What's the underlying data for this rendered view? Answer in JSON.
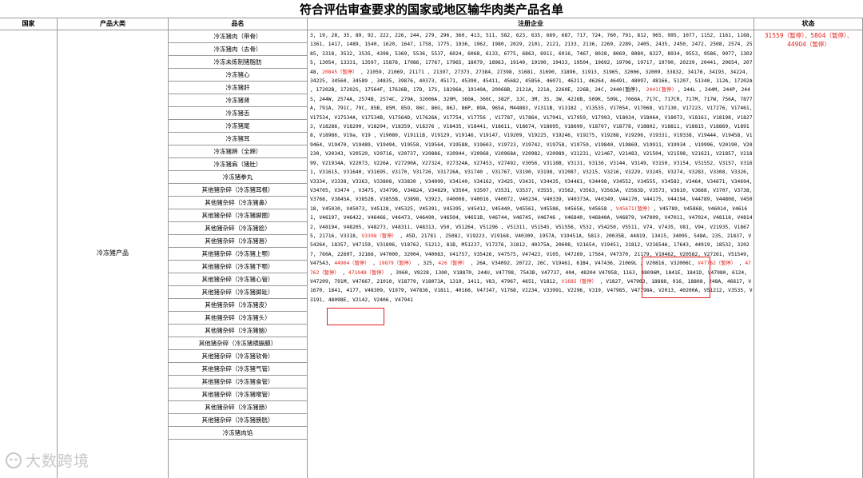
{
  "title": "符合评估审查要求的国家或地区输华肉类产品名单",
  "columns": {
    "country": "国家",
    "category": "产品大类",
    "product": "品名",
    "enterprises": "注册企业",
    "status": "状态"
  },
  "category": "冷冻猪产品",
  "products": [
    "冷冻猪肉（带骨）",
    "冷冻猪肉（去骨）",
    "冷冻未炼制猪脂肪",
    "冷冻猪心",
    "冷冻猪肝",
    "冷冻猪肾",
    "冷冻猪舌",
    "冷冻猪尾",
    "冷冻猪耳",
    "冷冻猪蹄（全蹄）",
    "冷冻猪肩（猪肚）",
    "冷冻猪拳丸",
    "其他猪杂碎（冷冻猪耳根）",
    "其他猪杂碎（冷冻猪鼻）",
    "其他猪杂碎（冷冻猪脚圈）",
    "其他猪杂碎（冷冻猪脸）",
    "其他猪杂碎（冷冻猪唇）",
    "其他猪杂碎（冷冻猪上颚）",
    "其他猪杂碎（冷冻猪下颚）",
    "其他猪杂碎（冷冻猪心管）",
    "其他猪杂碎（冷冻猪脚趾）",
    "其他猪杂碎（冷冻猪皮）",
    "其他猪杂碎（冷冻猪头）",
    "其他猪杂碎（冷冻猪脑）",
    "其他猪杂碎（冷冻猪横膈膜）",
    "其他猪杂碎（冷冻猪软骨）",
    "其他猪杂碎（冷冻猪气管）",
    "其他猪杂碎（冷冻猪食管）",
    "其他猪杂碎（冷冻猪喉管）",
    "其他猪杂碎（冷冻猪肠）",
    "其他猪杂碎（冷冻猪膀胱）",
    "冷冻猪肉馅"
  ],
  "registered_segments": [
    {
      "t": "3, 19, 28, 35, 89, 92, 222, 226, 244, 279, 296, 360, 413, 511, 582, 623, 635, 669, 687, 717, 724, 760, 791, 812, 965, 995, 1077, 1152, 1161, 1168, 1361, 1417, 1489, 1540, 1620, 1647, 1758, 1775, 1936, 1962, 1980, 2029, 2101, 2121, 2133, 2136, 2269, 2289, 2405, 2435, 2450, 2472, 2508, 2574, 2585, 3318, 3532, 3535, 4398, 5369, 5536, 5537, 6024, 6068, 6133, 6775, 6863, 6911, 6916, 7467, 8028, 8069, 8080, 8327, 8934, 9553, 9586, 9977, 13025, 13054, 13331, 13597, 15878, 17086, 17767, 17965, 18079, 18963, 19140, 19190, 19433, 19504, 19692, 19706, 19717, 19790, 20239, 20441, 20654, 20748, ",
      "r": false
    },
    {
      "t": "20845（暂停）",
      "r": true
    },
    {
      "t": " , 21059, 21069, 21171 , 21397, 27373, 27384, 27398, 31681, 31690, 31896, 31913, 31965, 32006, 32009, 33832, 34176, 34193, 34224, 34225, 34560, 34589 , 34835, 39876, 40373, 45171, 45390, 45411, 45682, 45856, 46071, 46211, 46264, 46491, 48097, 48166, 51207, 51340, 112A, 17202A , 17202B, 17202S, 17564F, 17626B, 17D, 17S, 18296A, 19140A, 20968B, 2121A, 221A, 2260E, 226B, 24C, 2440(暂停)，",
      "r": false
    },
    {
      "t": " 2441(暂停)",
      "r": true
    },
    {
      "t": " , 244L , 244M, 244P, 244S, 244W, 2574A, 2574B, 2574C, 279A, 32006A, 320M, 360A, 360C, 382F, 3JC, 3M, 3S, 3W, 4226B, 509K, 509L, 7066A, 717C, 717CR, 717M, 717W, 756A, 7877A, 791A, 791C, 79C, 85B, 85M, 85O, 86C, 86G, 86J, 86P, 89A, 965A, M44883, V1311B, V13182 , V13535, V17054, V17068, V17130, V17223, V17276, V17461, V17534, V17534A, V17534B, V17564D, V17626A, V17754, V17756 , V17787, V17864, V17941, V17959, V17993, V18034, V18064, V18073, V18161, V18198, V18273, V18286, V18290, V18294, V18359, V18376 , V18435, V18441, V18611, V18674, V18695, V18699, V18707, V18778, V18802, V18811, V18815, V18869, V18918, V18986, V19a, V19 , V19080, V19111B, V19129, V19146, V19147, V19209, V19225, V19246, V19275, V19288, V19296, V19331, V19338, V19444, V19458, V19464, V19470, V19489, V19494, V19558, V19564, V19588, V19603, V19723, V19742, V19758, V19759, V19840, V19869, V19911, V19934 , V19996, V20190, V20230, V20343, V20520, V20716, V20737, V20886, V20944, V20968, V20968A, V20982, V20989, V21231, V21467, V21483, V21504, V21598, V21621, V21857, V21899, V21934A, V22073, V226A, V27290A, V27324, V27324A, V27453, V27492, V3056, V3116B, V3131, V3136, V3144, V3149, V3150, V3154, V31552, V3157, V3161, V31615, V31640, V31695, V3170, V31726, V31726A, V31740 , V31767, V3190, V3198, V32087, V3215, V3216, V3229, V3245, V3274, V3283, V3308, V3326, V3334, V3338, V3363, V33808, V33830 , V34099, V34140, V34162, V3425, V3431, V34435, V34461, V34498, V34552, V34555, V34582, V3464, V34671, V34694, V34705, V3474 , V3475, V34796, V34824, V34829, V3504, V3507, V3531, V3537, V3555, V3562, V3563, V3563A, V3563D, V3573, V3610, V3688, V3707, V3738, V3768, V3845A, V3852B, V3855B, V3898, V3923, V40008, V40016, V40072, V40234, V40339, V40373A, V40349, V44170, V44175, V44194, V44789, V44808, V45018, V45030, V45073, V45128, V45325, V45391, V45395, V45412, V45440, V45561, V45586, V45656, V45658 , ",
      "r": false
    },
    {
      "t": "V45671(暂停)",
      "r": true
    },
    {
      "t": " , V45789, V45868, V46014, V46161, V46197, V46422, V46466, V46473, V46490, V46504, V4651B, V46744, V46745, V46746 , V46840, V46840A, V46879, V47009, V47011, V47024, V48118, V48142, V48194, V48205, V48273, V48311, V48313, V50, V51264, V51296 , V51311, V51545, V51556, V532, V54250, V5511, V74, V7435, V81, V94, V21935, V18675, 21716, V3318, ",
      "r": false
    },
    {
      "t": "V3398（暂停）",
      "r": true
    },
    {
      "t": " , 45D, 21781 , 2508J, V19223, V19168, V40309, 1957A, V19451A, 5813, 20035B, 44819, 13415, 34095, 548A, 235, 21837, V54264, 18357, V47159, V31896, V18762, 51212, 81B, M51237, V17276, 31812, 40375A, 20608, V21654, V19451, 31812, V21654A, 17643, 44919, 18532, 32027, 760A, 2260T, 32166, V47000, 32004, V40083, V41757, V35426, V47575, V47423, V105, V47269, 17564, V47370, 21179, V19462, V20582, V27261, V51549, V47543, ",
      "r": false
    },
    {
      "t": "44904（暂停）",
      "r": true
    },
    {
      "t": " , ",
      "r": false
    },
    {
      "t": "19879（暂停）",
      "r": true
    },
    {
      "t": " , 325, ",
      "r": false
    },
    {
      "t": "426（暂停）",
      "r": true
    },
    {
      "t": " , 26A, V34092, 20722, 26C, V19461, 61B4, V47436, 21069L , V20816, V32006C, ",
      "r": false
    },
    {
      "t": "V47762（暂停）",
      "r": true
    },
    {
      "t": " , ",
      "r": false
    },
    {
      "t": "47762（暂停）",
      "r": true
    },
    {
      "t": " , ",
      "r": false
    },
    {
      "t": "47104B（暂停）",
      "r": true
    },
    {
      "t": " , 3960, V9228, 1300, V18870, 244U, V47798, 7543B, V47737, 404, 48204 V47958, 1163, 48096M, 1841E, 1841D, V47980, 6124, V47209, 791M, V47667, 21010, V18779, V18073A, 1319, 1411, V83, 47967, 4651, V1812, ",
      "r": false
    },
    {
      "t": "V1685（暂停）",
      "r": true
    },
    {
      "t": " , V1827, V47903, 18888, 916, 18808, 248A, 46617, V1670, 1841, 4177, V48309, V1979, V47836, V1811, 40168, V47347, V1768, V2234, V33991, V2296, V319, V47985, V47798A, V2013, 40200A, V51212, V3535, V3191, 48098E, V2142, V2406, V47941",
      "r": false
    }
  ],
  "status_lines": [
    "31559（暂停）、5804（暂停）、",
    "44904（暂停）"
  ],
  "watermark": "大数跨境",
  "colors": {
    "suspended": "#e0201a",
    "grid": "#9a9a9a",
    "watermark": "#c8c8c8"
  }
}
